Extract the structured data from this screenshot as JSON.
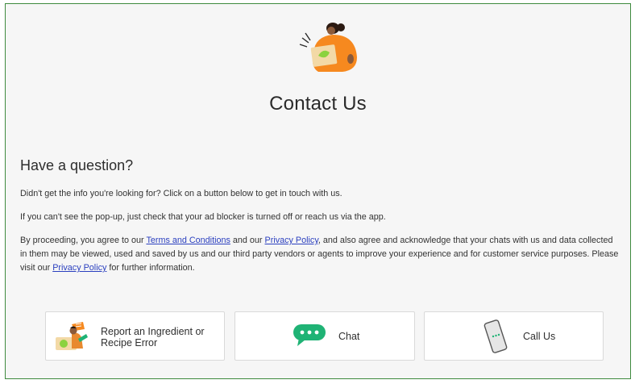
{
  "page": {
    "title": "Contact Us"
  },
  "section": {
    "heading": "Have a question?",
    "intro": "Didn't get the info you're looking for? Click on a button below to get in touch with us.",
    "popup_note": "If you can't see the pop-up, just check that your ad blocker is turned off or reach us via the app.",
    "consent": {
      "part1": "By proceeding, you agree to our ",
      "terms_link": "Terms and Conditions",
      "part2": " and our ",
      "privacy_link": "Privacy Policy",
      "part3": ", and also agree and acknowledge that your chats with us and data collected in them may be viewed, used and saved by us and our third party vendors or agents to improve your experience and for customer service purposes. Please visit our ",
      "privacy_link_2": "Privacy Policy",
      "part4": " for further information."
    }
  },
  "actions": {
    "report": {
      "label": "Report an Ingredient or Recipe Error",
      "icon": "report-illustration-icon"
    },
    "chat": {
      "label": "Chat",
      "icon": "chat-bubble-icon"
    },
    "call": {
      "label": "Call Us",
      "icon": "phone-icon"
    }
  },
  "colors": {
    "accent_orange": "#f6891f",
    "chat_green": "#1fb375",
    "lime": "#8bd23f",
    "link": "#2a3fbf",
    "border_green": "#3e8a3e"
  }
}
